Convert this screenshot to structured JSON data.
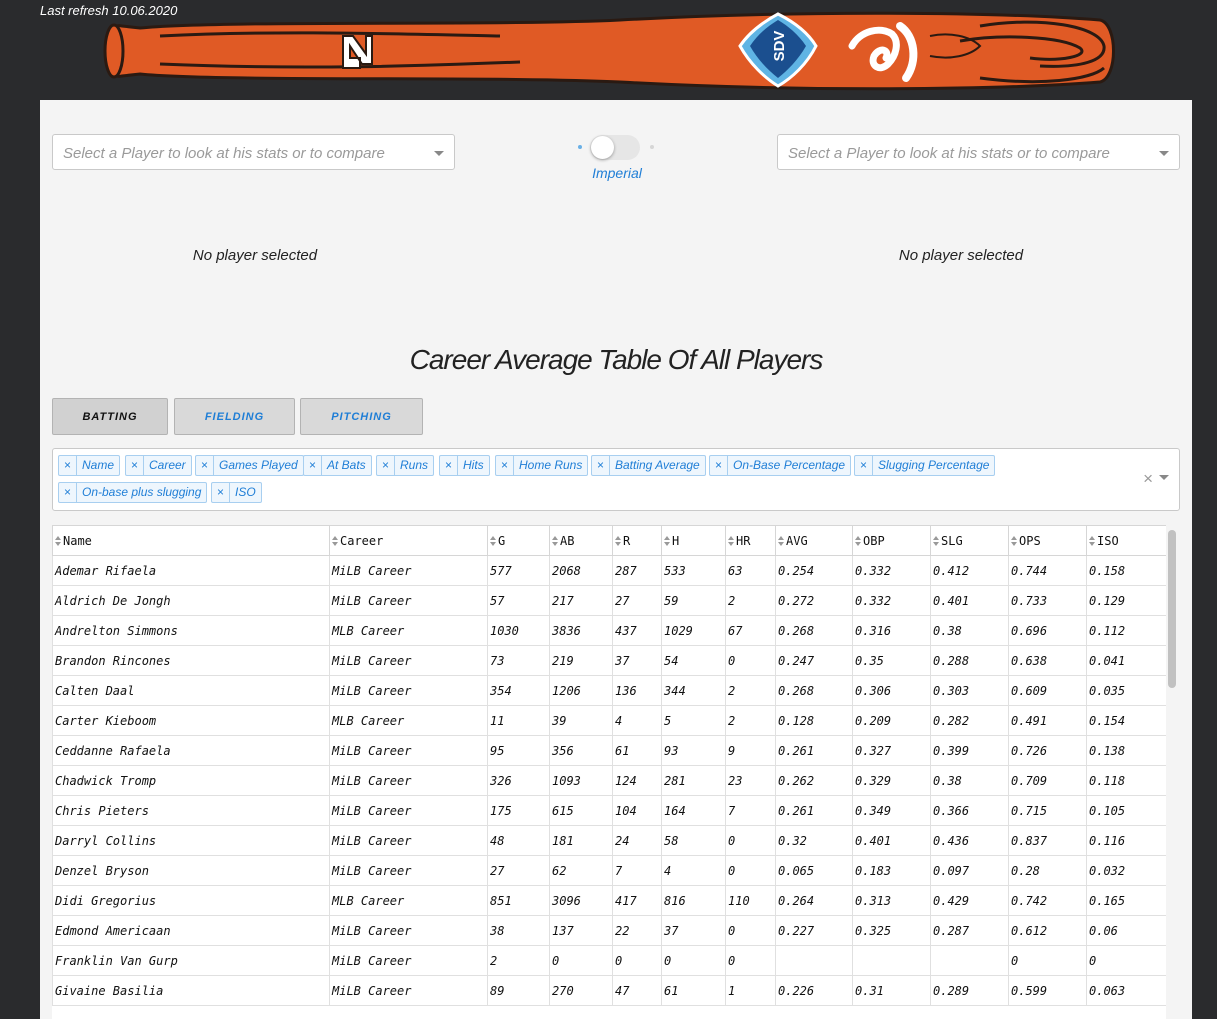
{
  "header": {
    "last_refresh": "Last refresh 10.06.2020",
    "logos": [
      "NL",
      "SDV"
    ],
    "colors": {
      "bat": "#e05a25",
      "bat_dark": "#2a1a12",
      "sdv_blue": "#1b4f8f"
    }
  },
  "selectors": {
    "left_placeholder": "Select a Player to look at his stats or to compare",
    "right_placeholder": "Select a Player to look at his stats or to compare"
  },
  "toggle": {
    "label": "Imperial"
  },
  "players": {
    "left_status": "No player selected",
    "right_status": "No player selected"
  },
  "table_title": "Career Average Table Of All Players",
  "tabs": [
    {
      "label": "BATTING",
      "active": true
    },
    {
      "label": "FIELDING",
      "active": false
    },
    {
      "label": "PITCHING",
      "active": false
    }
  ],
  "columns_selected": [
    "Name",
    "Career",
    "Games Played",
    "At Bats",
    "Runs",
    "Hits",
    "Home Runs",
    "Batting Average",
    "On-Base Percentage",
    "Slugging Percentage",
    "On-base plus slugging",
    "ISO"
  ],
  "table": {
    "headers": [
      "Name",
      "Career",
      "G",
      "AB",
      "R",
      "H",
      "HR",
      "AVG",
      "OBP",
      "SLG",
      "OPS",
      "ISO"
    ],
    "rows": [
      [
        "Ademar Rifaela",
        "MiLB Career",
        "577",
        "2068",
        "287",
        "533",
        "63",
        "0.254",
        "0.332",
        "0.412",
        "0.744",
        "0.158"
      ],
      [
        "Aldrich De Jongh",
        "MiLB Career",
        "57",
        "217",
        "27",
        "59",
        "2",
        "0.272",
        "0.332",
        "0.401",
        "0.733",
        "0.129"
      ],
      [
        "Andrelton Simmons",
        "MLB Career",
        "1030",
        "3836",
        "437",
        "1029",
        "67",
        "0.268",
        "0.316",
        "0.38",
        "0.696",
        "0.112"
      ],
      [
        "Brandon Rincones",
        "MiLB Career",
        "73",
        "219",
        "37",
        "54",
        "0",
        "0.247",
        "0.35",
        "0.288",
        "0.638",
        "0.041"
      ],
      [
        "Calten Daal",
        "MiLB Career",
        "354",
        "1206",
        "136",
        "344",
        "2",
        "0.268",
        "0.306",
        "0.303",
        "0.609",
        "0.035"
      ],
      [
        "Carter Kieboom",
        "MLB Career",
        "11",
        "39",
        "4",
        "5",
        "2",
        "0.128",
        "0.209",
        "0.282",
        "0.491",
        "0.154"
      ],
      [
        "Ceddanne Rafaela",
        "MiLB Career",
        "95",
        "356",
        "61",
        "93",
        "9",
        "0.261",
        "0.327",
        "0.399",
        "0.726",
        "0.138"
      ],
      [
        "Chadwick Tromp",
        "MiLB Career",
        "326",
        "1093",
        "124",
        "281",
        "23",
        "0.262",
        "0.329",
        "0.38",
        "0.709",
        "0.118"
      ],
      [
        "Chris Pieters",
        "MiLB Career",
        "175",
        "615",
        "104",
        "164",
        "7",
        "0.261",
        "0.349",
        "0.366",
        "0.715",
        "0.105"
      ],
      [
        "Darryl Collins",
        "MiLB Career",
        "48",
        "181",
        "24",
        "58",
        "0",
        "0.32",
        "0.401",
        "0.436",
        "0.837",
        "0.116"
      ],
      [
        "Denzel Bryson",
        "MiLB Career",
        "27",
        "62",
        "7",
        "4",
        "0",
        "0.065",
        "0.183",
        "0.097",
        "0.28",
        "0.032"
      ],
      [
        "Didi Gregorius",
        "MLB Career",
        "851",
        "3096",
        "417",
        "816",
        "110",
        "0.264",
        "0.313",
        "0.429",
        "0.742",
        "0.165"
      ],
      [
        "Edmond Americaan",
        "MiLB Career",
        "38",
        "137",
        "22",
        "37",
        "0",
        "0.227",
        "0.325",
        "0.287",
        "0.612",
        "0.06"
      ],
      [
        "Franklin Van Gurp",
        "MiLB Career",
        "2",
        "0",
        "0",
        "0",
        "0",
        "",
        "",
        "",
        "0",
        "0"
      ],
      [
        "Givaine Basilia",
        "MiLB Career",
        "89",
        "270",
        "47",
        "61",
        "1",
        "0.226",
        "0.31",
        "0.289",
        "0.599",
        "0.063"
      ]
    ]
  }
}
